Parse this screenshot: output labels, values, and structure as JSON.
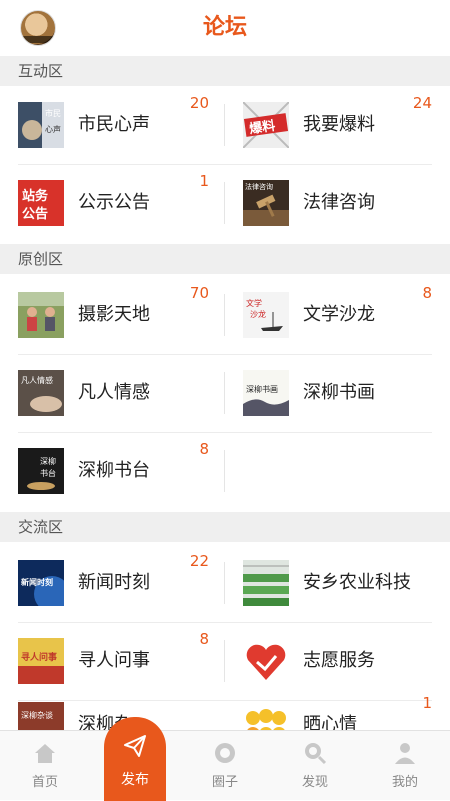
{
  "header": {
    "title": "论坛"
  },
  "sections": [
    {
      "label": "互动区"
    },
    {
      "label": "原创区"
    },
    {
      "label": "交流区"
    }
  ],
  "items": [
    {
      "label": "市民心声",
      "count": "20",
      "icon": "citizen-voice-thumb"
    },
    {
      "label": "我要爆料",
      "count": "24",
      "icon": "report-news-thumb"
    },
    {
      "label": "公示公告",
      "count": "1",
      "icon": "announcement-thumb"
    },
    {
      "label": "法律咨询",
      "count": "",
      "icon": "legal-advice-thumb"
    },
    {
      "label": "摄影天地",
      "count": "70",
      "icon": "photography-thumb"
    },
    {
      "label": "文学沙龙",
      "count": "8",
      "icon": "literature-thumb"
    },
    {
      "label": "凡人情感",
      "count": "",
      "icon": "emotion-thumb"
    },
    {
      "label": "深柳书画",
      "count": "",
      "icon": "calligraphy-thumb"
    },
    {
      "label": "深柳书台",
      "count": "8",
      "icon": "book-stage-thumb"
    },
    {
      "label": "新闻时刻",
      "count": "22",
      "icon": "news-thumb"
    },
    {
      "label": "安乡农业科技",
      "count": "",
      "icon": "agriculture-thumb"
    },
    {
      "label": "寻人问事",
      "count": "8",
      "icon": "search-people-thumb"
    },
    {
      "label": "志愿服务",
      "count": "",
      "icon": "volunteer-heart-thumb"
    },
    {
      "label": "深柳杂",
      "count": "",
      "icon": "chat-thumb"
    },
    {
      "label": "晒心情",
      "count": "1",
      "icon": "emoji-thumb"
    }
  ],
  "thumb_text": {
    "citizen": "市民心声",
    "report": "爆料",
    "announce_top": "站务",
    "announce_bottom": "公告",
    "legal": "法律咨询",
    "literature": "文学沙龙",
    "emotion": "凡人情感",
    "calligraphy": "深柳书画",
    "bookstage": "深柳书台",
    "news": "新闻时刻",
    "search": "寻人问事",
    "chat": "深柳杂谈"
  },
  "tabbar": {
    "home": "首页",
    "publish": "发布",
    "circle": "圈子",
    "discover": "发现",
    "mine": "我的"
  },
  "colors": {
    "accent": "#e8581c"
  }
}
